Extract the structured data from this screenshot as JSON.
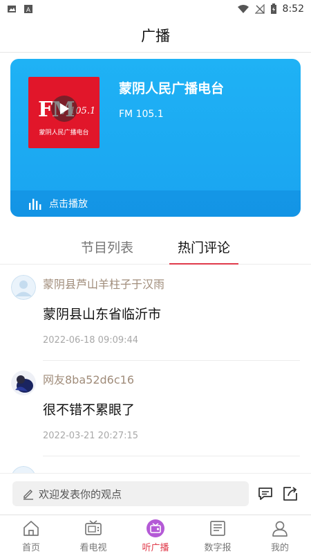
{
  "status_bar": {
    "time": "8:52"
  },
  "header": {
    "title": "广播"
  },
  "station": {
    "logo_text": "FM",
    "logo_freq": "105.1",
    "logo_subtitle": "蒙阴人民广播电台",
    "name": "蒙阴人民广播电台",
    "frequency": "FM 105.1",
    "play_label": "点击播放"
  },
  "tabs": [
    {
      "label": "节目列表",
      "active": false
    },
    {
      "label": "热门评论",
      "active": true
    }
  ],
  "comments": [
    {
      "user": "蒙阴县芦山羊柱子于汉雨",
      "text": "蒙阴县山东省临沂市",
      "time": "2022-06-18 09:09:44"
    },
    {
      "user": "网友8ba52d6c16",
      "text": "很不错不累眼了",
      "time": "2022-03-21 20:27:15"
    }
  ],
  "comment_input": {
    "placeholder": "欢迎发表你的观点"
  },
  "bottom_nav": [
    {
      "label": "首页",
      "icon": "home-icon",
      "active": false
    },
    {
      "label": "看电视",
      "icon": "tv-icon",
      "active": false
    },
    {
      "label": "听广播",
      "icon": "radio-icon",
      "active": true
    },
    {
      "label": "数字报",
      "icon": "newspaper-icon",
      "active": false
    },
    {
      "label": "我的",
      "icon": "user-icon",
      "active": false
    }
  ],
  "colors": {
    "accent": "#e03a4a",
    "card_blue": "#1fb2f5",
    "logo_red": "#e1162a"
  }
}
